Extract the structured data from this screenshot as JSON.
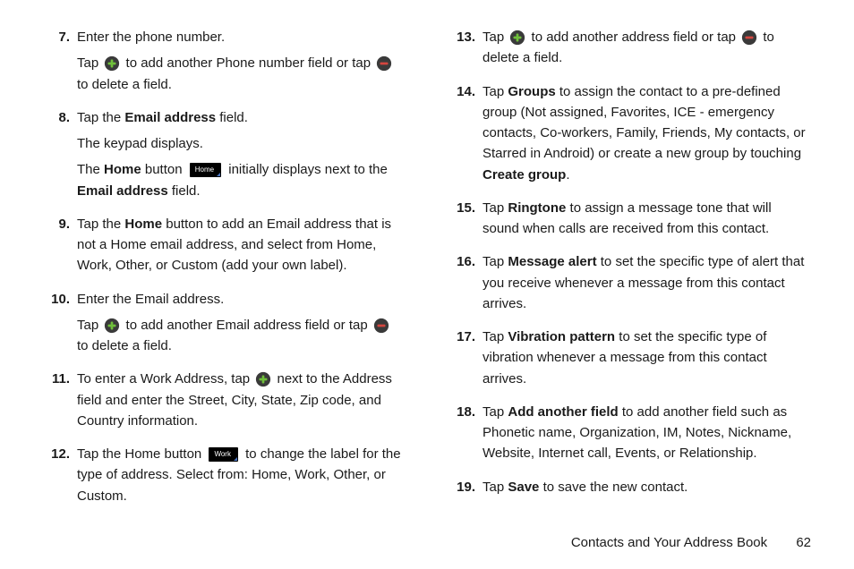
{
  "icons": {
    "plus": "plus-icon",
    "minus": "minus-icon"
  },
  "buttons": {
    "home_label": "Home",
    "work_label": "Work"
  },
  "left": [
    {
      "num": "7.",
      "paras": [
        [
          {
            "t": "Enter the phone number."
          }
        ],
        [
          {
            "t": "Tap "
          },
          {
            "icon": "plus"
          },
          {
            "t": " to add another Phone number field or tap "
          },
          {
            "icon": "minus"
          },
          {
            "t": " to delete a field."
          }
        ]
      ]
    },
    {
      "num": "8.",
      "paras": [
        [
          {
            "t": "Tap the "
          },
          {
            "b": "Email address"
          },
          {
            "t": " field."
          }
        ],
        [
          {
            "t": "The keypad displays."
          }
        ],
        [
          {
            "t": "The "
          },
          {
            "b": "Home"
          },
          {
            "t": " button "
          },
          {
            "btn": "home_label"
          },
          {
            "t": " initially displays next to the "
          },
          {
            "b": "Email address"
          },
          {
            "t": " field."
          }
        ]
      ]
    },
    {
      "num": "9.",
      "paras": [
        [
          {
            "t": "Tap the "
          },
          {
            "b": "Home"
          },
          {
            "t": " button to add an Email address that is not a Home email address, and select from Home, Work, Other, or Custom (add your own label)."
          }
        ]
      ]
    },
    {
      "num": "10.",
      "paras": [
        [
          {
            "t": "Enter the Email address."
          }
        ],
        [
          {
            "t": "Tap "
          },
          {
            "icon": "plus"
          },
          {
            "t": " to add another Email address field or tap "
          },
          {
            "icon": "minus"
          },
          {
            "t": " to delete a field."
          }
        ]
      ]
    },
    {
      "num": "11.",
      "paras": [
        [
          {
            "t": "To enter a Work Address, tap "
          },
          {
            "icon": "plus"
          },
          {
            "t": " next to the Address field and enter the Street, City, State, Zip code, and Country information."
          }
        ]
      ]
    },
    {
      "num": "12.",
      "paras": [
        [
          {
            "t": "Tap the Home button "
          },
          {
            "btn": "work_label"
          },
          {
            "t": " to change the label for the type of address. Select from: Home, Work, Other, or Custom."
          }
        ]
      ]
    }
  ],
  "right": [
    {
      "num": "13.",
      "paras": [
        [
          {
            "t": "Tap "
          },
          {
            "icon": "plus"
          },
          {
            "t": " to add another address field or tap "
          },
          {
            "icon": "minus"
          },
          {
            "t": " to delete a field."
          }
        ]
      ]
    },
    {
      "num": "14.",
      "paras": [
        [
          {
            "t": "Tap "
          },
          {
            "b": "Groups"
          },
          {
            "t": " to assign the contact to a pre-defined group (Not assigned, Favorites, ICE - emergency contacts, Co-workers, Family, Friends, My contacts, or Starred in Android) or create a new group by touching "
          },
          {
            "b": "Create group"
          },
          {
            "t": "."
          }
        ]
      ]
    },
    {
      "num": "15.",
      "paras": [
        [
          {
            "t": "Tap "
          },
          {
            "b": "Ringtone"
          },
          {
            "t": " to assign a message tone that will sound when calls are received from this contact."
          }
        ]
      ]
    },
    {
      "num": "16.",
      "paras": [
        [
          {
            "t": "Tap "
          },
          {
            "b": "Message alert"
          },
          {
            "t": " to set the specific type of alert that you receive whenever a message from this contact arrives."
          }
        ]
      ]
    },
    {
      "num": "17.",
      "paras": [
        [
          {
            "t": "Tap "
          },
          {
            "b": "Vibration pattern"
          },
          {
            "t": " to set the specific type of vibration whenever a message from this contact arrives."
          }
        ]
      ]
    },
    {
      "num": "18.",
      "paras": [
        [
          {
            "t": "Tap "
          },
          {
            "b": "Add another field"
          },
          {
            "t": " to add another field such as Phonetic name, Organization, IM, Notes, Nickname, Website, Internet call, Events, or Relationship."
          }
        ]
      ]
    },
    {
      "num": "19.",
      "paras": [
        [
          {
            "t": "Tap "
          },
          {
            "b": "Save"
          },
          {
            "t": " to save the new contact."
          }
        ]
      ]
    }
  ],
  "footer": {
    "section": "Contacts and Your Address Book",
    "page": "62"
  }
}
